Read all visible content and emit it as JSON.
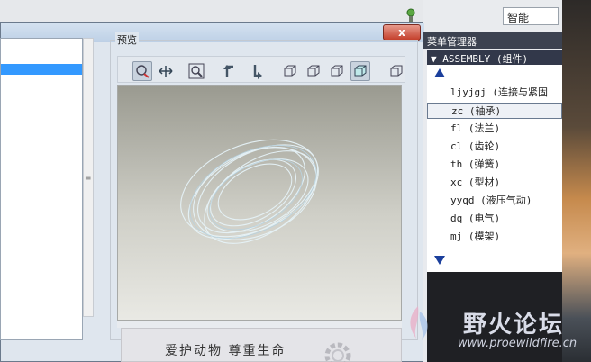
{
  "top": {
    "smart_select": "智能"
  },
  "dialog": {
    "close_label": "x"
  },
  "preview": {
    "label": "预览"
  },
  "watermark_panel": {
    "text": "爱护动物 尊重生命"
  },
  "menu_manager": {
    "title": "菜单管理器",
    "assembly_header": "ASSEMBLY (组件)",
    "items": [
      {
        "label": "ljyjgj (连接与紧固"
      },
      {
        "label": "zc (轴承)"
      },
      {
        "label": "fl (法兰)"
      },
      {
        "label": "cl (齿轮)"
      },
      {
        "label": "th (弹簧)"
      },
      {
        "label": "xc (型材)"
      },
      {
        "label": "yyqd (液压气动)"
      },
      {
        "label": "dq (电气)"
      },
      {
        "label": "mj (模架)"
      }
    ]
  },
  "site": {
    "name": "野火论坛",
    "url": "www.proewildfire.cn"
  }
}
